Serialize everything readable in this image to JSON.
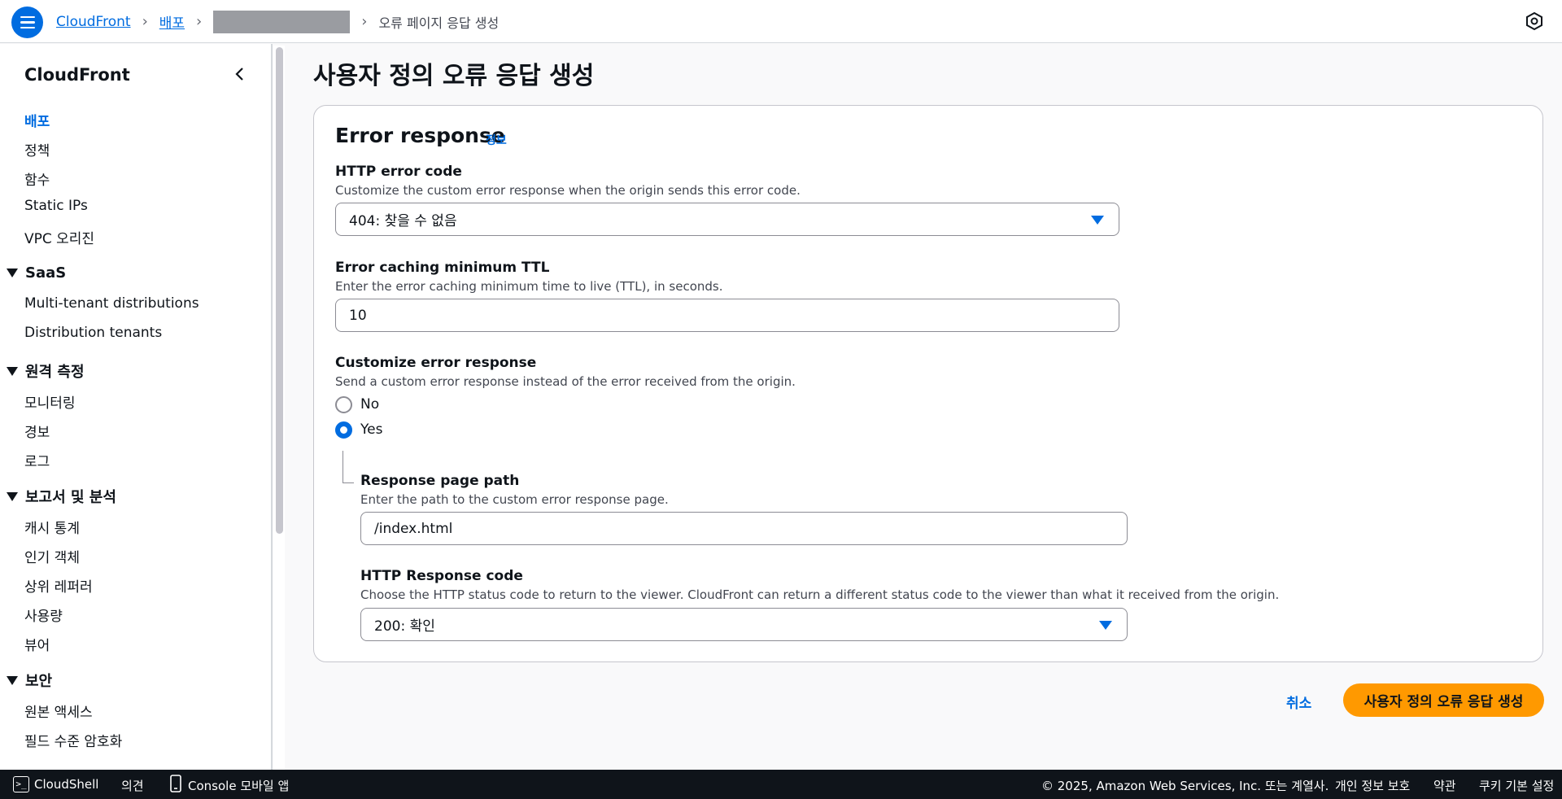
{
  "breadcrumb": {
    "root": "CloudFront",
    "section": "배포",
    "current": "오류 페이지 응답 생성"
  },
  "sidebar": {
    "title": "CloudFront",
    "top_items": [
      "배포",
      "정책",
      "함수",
      "Static IPs",
      "VPC 오리진"
    ],
    "sections": [
      {
        "title": "SaaS",
        "items": [
          "Multi-tenant distributions",
          "Distribution tenants"
        ]
      },
      {
        "title": "원격 측정",
        "items": [
          "모니터링",
          "경보",
          "로그"
        ]
      },
      {
        "title": "보고서 및 분석",
        "items": [
          "캐시 통계",
          "인기 객체",
          "상위 레퍼러",
          "사용량",
          "뷰어"
        ]
      },
      {
        "title": "보안",
        "items": [
          "원본 액세스",
          "필드 수준 암호화"
        ]
      }
    ]
  },
  "page": {
    "title": "사용자 정의 오류 응답 생성"
  },
  "card": {
    "title": "Error response",
    "info": "정보",
    "http_error_code": {
      "label": "HTTP error code",
      "description": "Customize the custom error response when the origin sends this error code.",
      "value": "404: 찾을 수 없음"
    },
    "ttl": {
      "label": "Error caching minimum TTL",
      "description": "Enter the error caching minimum time to live (TTL), in seconds.",
      "value": "10"
    },
    "customize": {
      "label": "Customize error response",
      "description": "Send a custom error response instead of the error received from the origin.",
      "option_no": "No",
      "option_yes": "Yes",
      "selected": "Yes"
    },
    "response_path": {
      "label": "Response page path",
      "description": "Enter the path to the custom error response page.",
      "value": "/index.html"
    },
    "response_code": {
      "label": "HTTP Response code",
      "description": "Choose the HTTP status code to return to the viewer. CloudFront can return a different status code to the viewer than what it received from the origin.",
      "value": "200: 확인"
    }
  },
  "actions": {
    "cancel": "취소",
    "create": "사용자 정의 오류 응답 생성"
  },
  "footer": {
    "cloudshell": "CloudShell",
    "feedback": "의견",
    "mobile": "Console 모바일 앱",
    "copyright": "© 2025, Amazon Web Services, Inc. 또는 계열사.",
    "privacy": "개인 정보 보호",
    "terms": "약관",
    "cookies": "쿠키 기본 설정"
  },
  "colors": {
    "accent": "#006ce0",
    "primary_button": "#ff9900",
    "footer_bg": "#0f141a"
  }
}
